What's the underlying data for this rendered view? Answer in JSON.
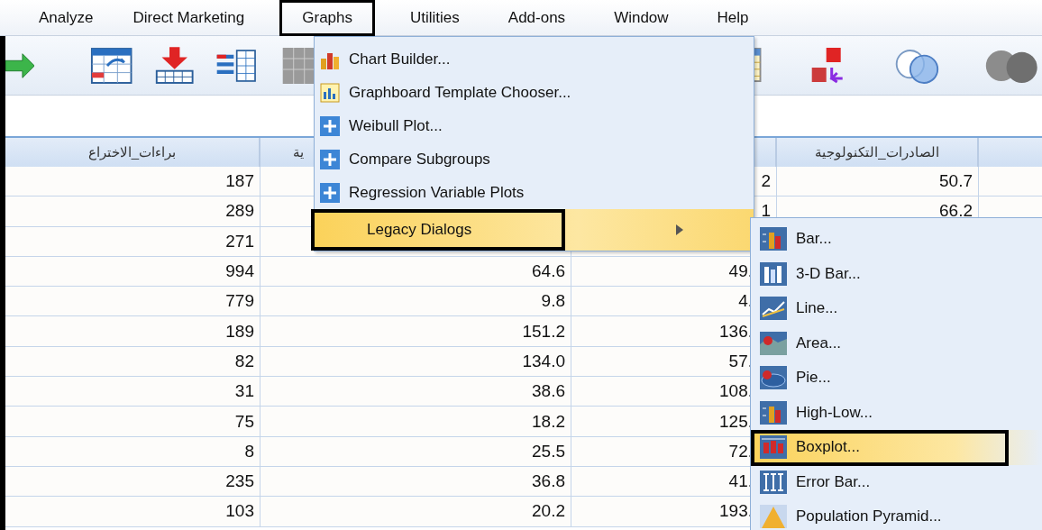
{
  "menu_bar": [
    {
      "label": "Analyze",
      "selected": false
    },
    {
      "label": "Direct Marketing",
      "selected": false
    },
    {
      "label": "Graphs",
      "selected": true
    },
    {
      "label": "Utilities",
      "selected": false
    },
    {
      "label": "Add-ons",
      "selected": false
    },
    {
      "label": "Window",
      "selected": false
    },
    {
      "label": "Help",
      "selected": false
    }
  ],
  "table": {
    "columns": [
      "براءات_الاختراع",
      "ية",
      null,
      "الصادرات_التكنولوجية",
      null
    ],
    "rows": [
      [
        "187",
        null,
        "2",
        "50.7",
        null
      ],
      [
        "289",
        null,
        "1",
        "66.2",
        null
      ],
      [
        "271",
        null,
        null,
        null,
        null
      ],
      [
        "994",
        "64.6",
        "49.",
        null,
        null
      ],
      [
        "779",
        "9.8",
        "4.",
        null,
        null
      ],
      [
        "189",
        "151.2",
        "136.",
        null,
        null
      ],
      [
        "82",
        "134.0",
        "57.",
        null,
        null
      ],
      [
        "31",
        "38.6",
        "108.",
        null,
        null
      ],
      [
        "75",
        "18.2",
        "125.",
        null,
        null
      ],
      [
        "8",
        "25.5",
        "72.",
        null,
        null
      ],
      [
        "235",
        "36.8",
        "41.",
        null,
        null
      ],
      [
        "103",
        "20.2",
        "193.",
        null,
        null
      ]
    ]
  },
  "graphs_menu": {
    "items": [
      {
        "label": "Chart Builder...",
        "kind": "chart-builder",
        "selected": false
      },
      {
        "label": "Graphboard Template Chooser...",
        "kind": "graphboard",
        "selected": false
      },
      {
        "label": "Weibull Plot...",
        "kind": "plus",
        "selected": false
      },
      {
        "label": "Compare Subgroups",
        "kind": "plus",
        "selected": false
      },
      {
        "label": "Regression Variable Plots",
        "kind": "plus",
        "selected": false
      },
      {
        "label": "Legacy Dialogs",
        "kind": "submenu",
        "selected": true
      }
    ]
  },
  "legacy_submenu": {
    "items": [
      {
        "label": "Bar...",
        "kind": "bar",
        "selected": false
      },
      {
        "label": "3-D Bar...",
        "kind": "bar3d",
        "selected": false
      },
      {
        "label": "Line...",
        "kind": "line",
        "selected": false
      },
      {
        "label": "Area...",
        "kind": "area",
        "selected": false
      },
      {
        "label": "Pie...",
        "kind": "pie",
        "selected": false
      },
      {
        "label": "High-Low...",
        "kind": "high-low",
        "selected": false
      },
      {
        "label": "Boxplot...",
        "kind": "boxplot",
        "selected": true
      },
      {
        "label": "Error Bar...",
        "kind": "error-bar",
        "selected": false
      },
      {
        "label": "Population Pyramid...",
        "kind": "pyramid",
        "selected": false
      }
    ]
  }
}
